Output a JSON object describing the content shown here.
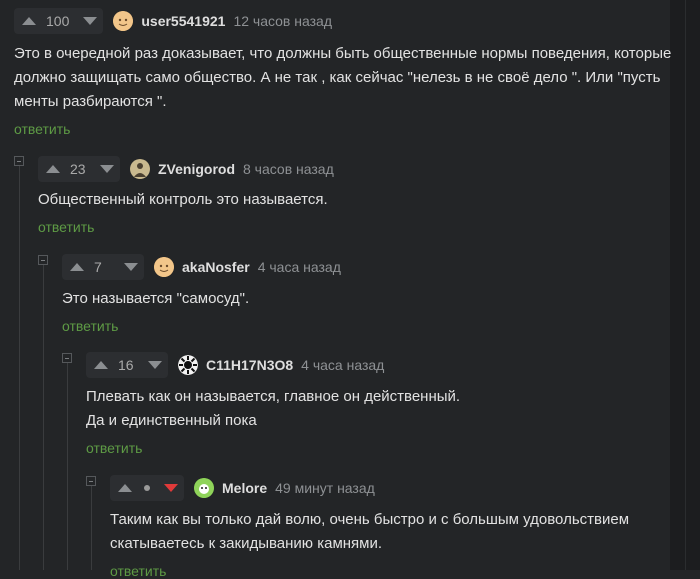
{
  "comments": [
    {
      "score": "100",
      "username": "user5541921",
      "time": "12 часов назад",
      "avatar_color": "#e8b068",
      "lines": [
        "Это в очередной раз доказывает, что должны быть общественные нормы поведения, которые",
        "должно защищать само общество. А не так , как сейчас \"нелезь в не своё дело \". Или \"пусть",
        "менты разбираются \"."
      ],
      "reply": "ответить"
    },
    {
      "score": "23",
      "username": "ZVenigorod",
      "time": "8 часов назад",
      "avatar_color": "#7a6f4f",
      "lines": [
        "Общественный контроль это называется."
      ],
      "reply": "ответить"
    },
    {
      "score": "7",
      "username": "akaNosfer",
      "time": "4 часа назад",
      "avatar_color": "#e8b068",
      "lines": [
        "Это называется \"самосуд\"."
      ],
      "reply": "ответить"
    },
    {
      "score": "16",
      "username": "C11H17N3O8",
      "time": "4 часа назад",
      "avatar_color": "#111111",
      "lines": [
        "Плевать как он называется, главное он действенный.",
        "Да и единственный пока"
      ],
      "reply": "ответить"
    },
    {
      "username": "Melore",
      "time": "49 минут назад",
      "avatar_color": "#6cbf3a",
      "lines": [
        "Таким как вы только дай волю, очень быстро и с большым удовольствием",
        "скатываетесь к закидыванию камнями."
      ],
      "reply": "ответить"
    }
  ],
  "colors": {
    "background": "#232527",
    "reply_link": "#5e9b45",
    "downvote_active": "#e03a3a"
  }
}
